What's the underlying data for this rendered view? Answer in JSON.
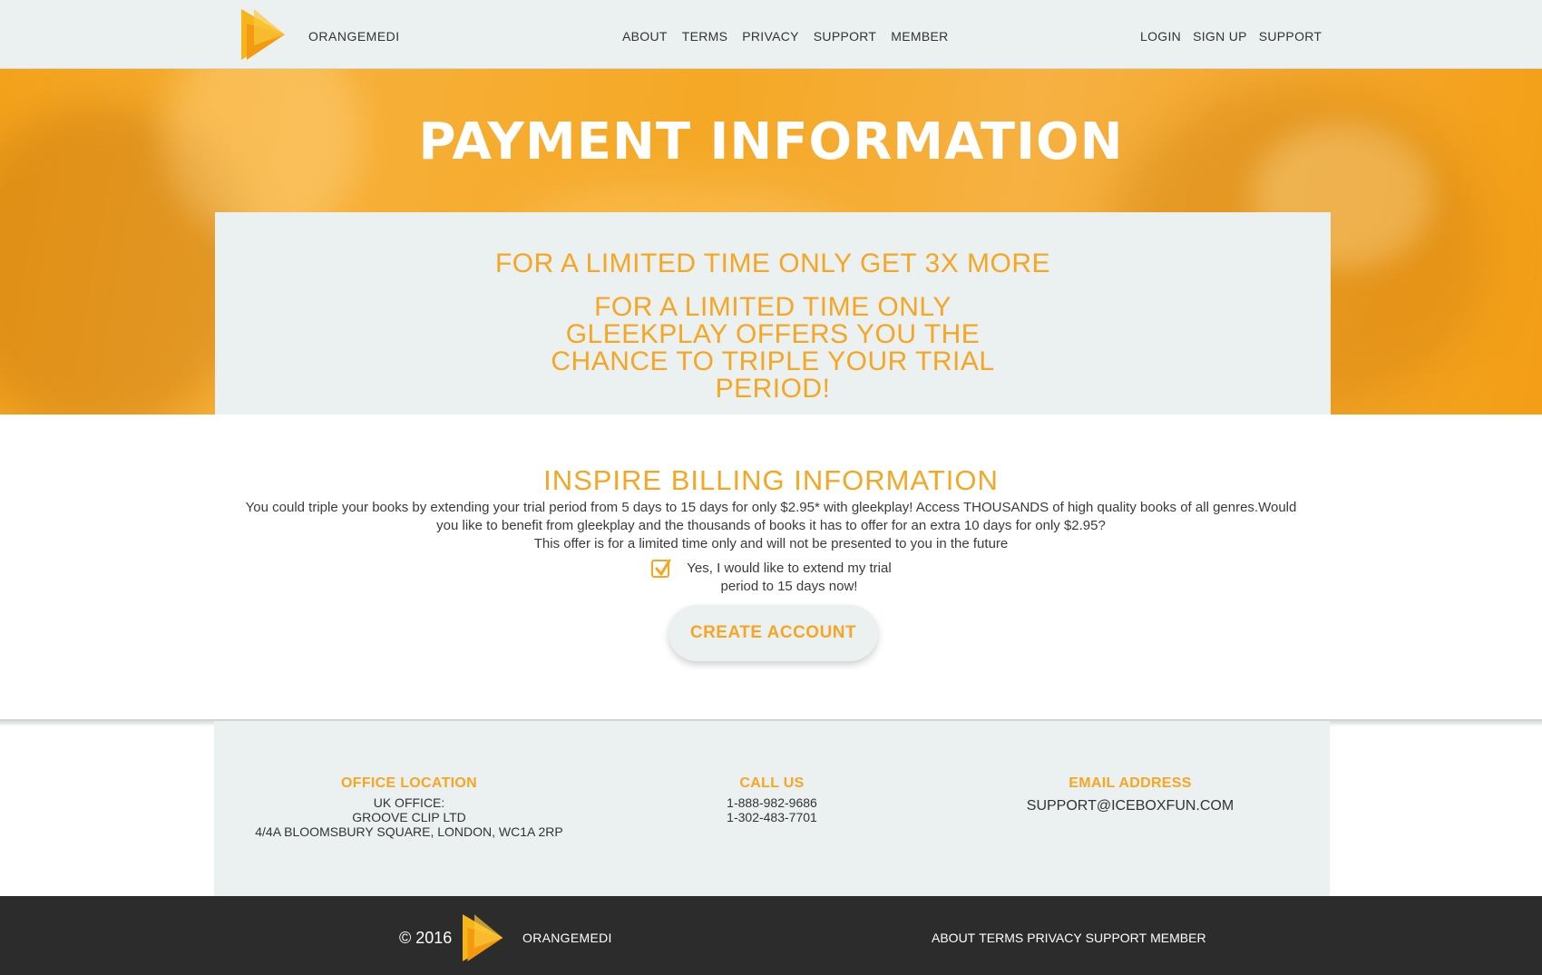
{
  "header": {
    "brand": "ORANGEMEDI",
    "nav": [
      "ABOUT",
      "TERMS",
      "PRIVACY",
      "SUPPORT",
      "MEMBER"
    ],
    "account_nav": [
      "LOGIN",
      "SIGN UP",
      "SUPPORT"
    ]
  },
  "hero": {
    "title": "PAYMENT INFORMATION",
    "offer_headline": "FOR A LIMITED TIME ONLY GET 3X MORE",
    "offer_body": "FOR A LIMITED TIME ONLY GLEEKPLAY OFFERS YOU THE CHANCE TO TRIPLE YOUR TRIAL PERIOD!"
  },
  "billing": {
    "title": "INSPIRE  BILLING INFORMATION",
    "description_line1": "You could triple your books by extending your trial period from 5 days to 15 days for only $2.95* with gleekplay! Access THOUSANDS of high quality books of all genres.Would you like to benefit from gleekplay and the thousands of books it has to offer for an extra 10 days for only $2.95?",
    "description_line2": "This offer is for a limited time only and will not be presented to you in the future",
    "checkbox_label": "Yes, I would like to extend my trial period to 15 days now!",
    "checkbox_checked": true,
    "button_label": "CREATE ACCOUNT"
  },
  "contact": {
    "office": {
      "heading": "OFFICE LOCATION",
      "line1": "UK OFFICE:",
      "line2": "GROOVE CLIP LTD",
      "line3": "4/4A BLOOMSBURY SQUARE, LONDON, WC1A 2RP"
    },
    "call": {
      "heading": "CALL US",
      "phone1": "1-888-982-9686",
      "phone2": "1-302-483-7701"
    },
    "email": {
      "heading": "EMAIL ADDRESS",
      "address": "SUPPORT@ICEBOXFUN.COM"
    }
  },
  "footer": {
    "copyright": "© 2016",
    "brand": "ORANGEMEDI",
    "nav": [
      "ABOUT",
      "TERMS",
      "PRIVACY",
      "SUPPORT",
      "MEMBER"
    ]
  },
  "colors": {
    "accent": "#f5a623",
    "header_bg": "#ebf0f0",
    "footer_bg": "#2c2c2c"
  },
  "icons": {
    "logo": "play-triangle-logo-icon",
    "checkbox": "checkmark-icon"
  }
}
